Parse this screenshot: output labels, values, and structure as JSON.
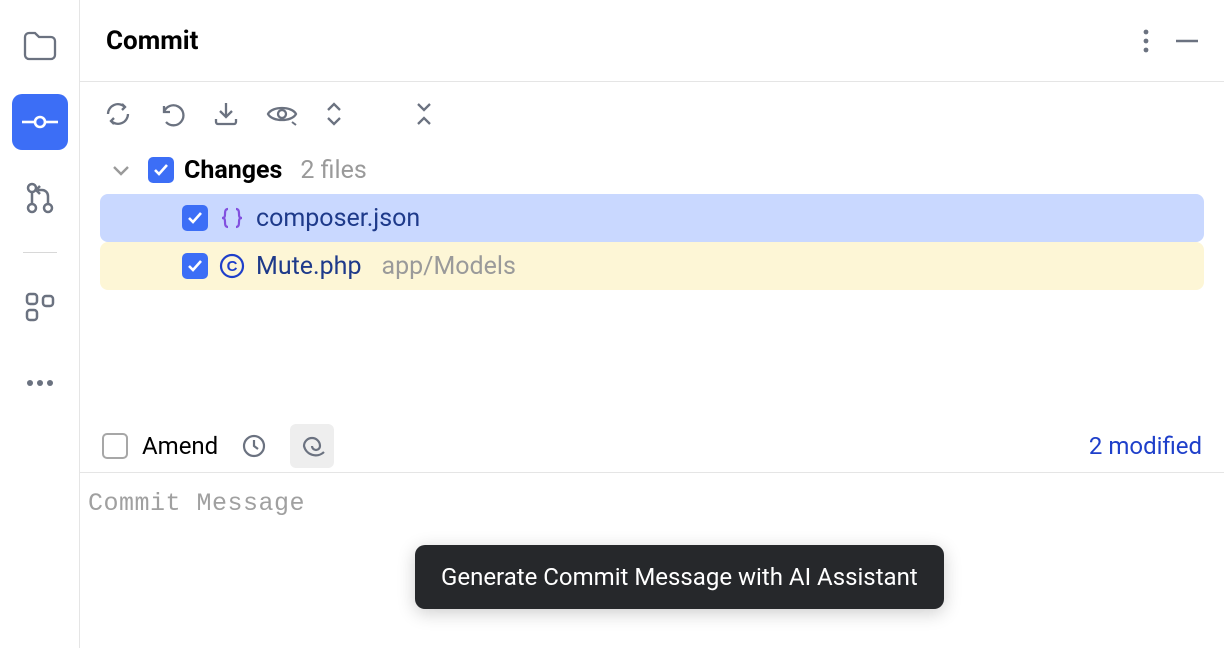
{
  "header": {
    "title": "Commit"
  },
  "changes": {
    "label": "Changes",
    "count": "2 files",
    "files": [
      {
        "name": "composer.json",
        "path": ""
      },
      {
        "name": "Mute.php",
        "path": "app/Models"
      }
    ]
  },
  "amend": {
    "label": "Amend"
  },
  "status": {
    "modified": "2 modified"
  },
  "commit_message": {
    "placeholder": "Commit Message"
  },
  "tooltip": {
    "text": "Generate Commit Message with AI Assistant"
  }
}
